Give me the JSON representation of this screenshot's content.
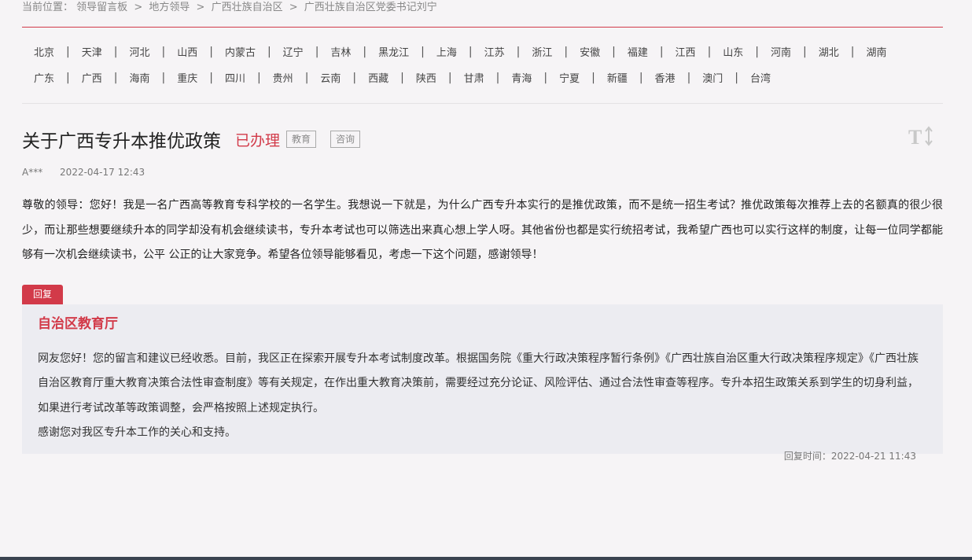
{
  "breadcrumb": {
    "prefix": "当前位置：",
    "items": [
      "领导留言板",
      "地方领导",
      "广西壮族自治区",
      "广西壮族自治区党委书记刘宁"
    ],
    "separator": ">"
  },
  "regions": {
    "row1": [
      "北京",
      "天津",
      "河北",
      "山西",
      "内蒙古",
      "辽宁",
      "吉林",
      "黑龙江",
      "上海",
      "江苏",
      "浙江",
      "安徽",
      "福建",
      "江西",
      "山东",
      "河南",
      "湖北",
      "湖南"
    ],
    "row2": [
      "广东",
      "广西",
      "海南",
      "重庆",
      "四川",
      "贵州",
      "云南",
      "西藏",
      "陕西",
      "甘肃",
      "青海",
      "宁夏",
      "新疆",
      "香港",
      "澳门",
      "台湾"
    ],
    "divider": "|"
  },
  "post": {
    "title": "关于广西专升本推优政策",
    "status": "已办理",
    "tags": [
      "教育",
      "咨询"
    ],
    "author": "A***",
    "date": "2022-04-17 12:43",
    "content": "尊敬的领导：您好！我是一名广西高等教育专科学校的一名学生。我想说一下就是，为什么广西专升本实行的是推优政策，而不是统一招生考试？推优政策每次推荐上去的名额真的很少很少，而让那些想要继续升本的同学却没有机会继续读书，专升本考试也可以筛选出来真心想上学人呀。其他省份也都是实行统招考试，我希望广西也可以实行这样的制度，让每一位同学都能够有一次机会继续读书，公平 公正的让大家竞争。希望各位领导能够看见，考虑一下这个问题，感谢领导！"
  },
  "reply": {
    "label": "回复",
    "org": "自治区教育厅",
    "paragraph1": "网友您好！您的留言和建议已经收悉。目前，我区正在探索开展专升本考试制度改革。根据国务院《重大行政决策程序暂行条例》《广西壮族自治区重大行政决策程序规定》《广西壮族自治区教育厅重大教育决策合法性审查制度》等有关规定，在作出重大教育决策前，需要经过充分论证、风险评估、通过合法性审查等程序。专升本招生政策关系到学生的切身利益，如果进行考试改革等政策调整，会严格按照上述规定执行。",
    "paragraph2": "感谢您对我区专升本工作的关心和支持。",
    "time": "回复时间：2022-04-21 11:43"
  },
  "icons": {
    "font_toggle": "font-size-toggle-icon"
  },
  "colors": {
    "accent": "#d23a49",
    "background": "#f6f4f6",
    "reply_background": "#ececf1"
  }
}
